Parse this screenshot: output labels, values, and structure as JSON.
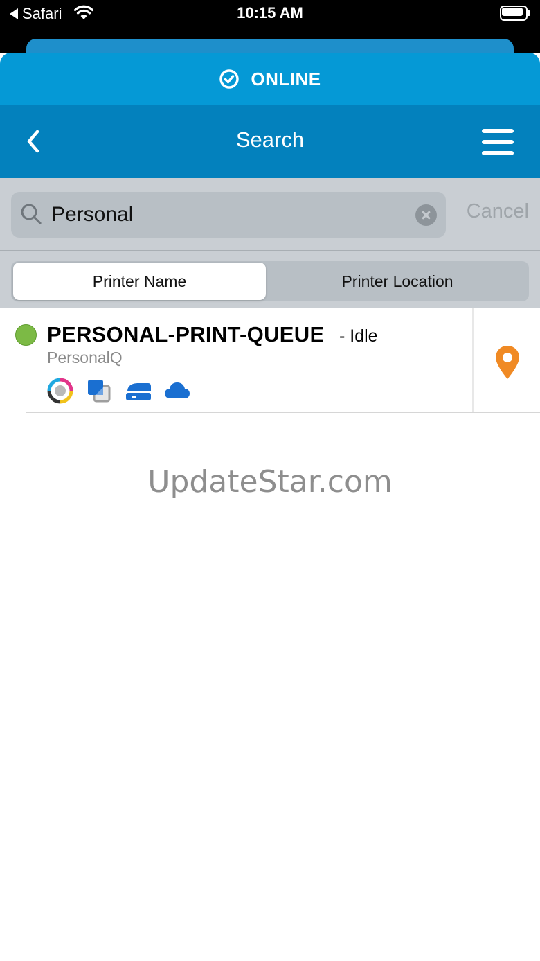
{
  "status_bar": {
    "back_app": "Safari",
    "time": "10:15 AM"
  },
  "banner": {
    "status_label": "ONLINE",
    "icon": "check-circle-icon"
  },
  "nav": {
    "title": "Search",
    "back_icon": "chevron-left-icon",
    "menu_icon": "hamburger-menu-icon"
  },
  "search": {
    "value": "Personal",
    "cancel_label": "Cancel"
  },
  "segments": {
    "selected": "Printer Name",
    "options": [
      "Printer Name",
      "Printer Location"
    ]
  },
  "results": [
    {
      "name": "PERSONAL-PRINT-QUEUE",
      "status": "- Idle",
      "subtitle": "PersonalQ",
      "status_color": "#7cba45",
      "features": [
        "color-print-icon",
        "duplex-icon",
        "staple-icon",
        "cloud-icon"
      ]
    }
  ],
  "watermark": "UpdateStar.com",
  "colors": {
    "banner": "#0599d6",
    "navbar": "#0381bd",
    "location_pin": "#f08a24"
  }
}
